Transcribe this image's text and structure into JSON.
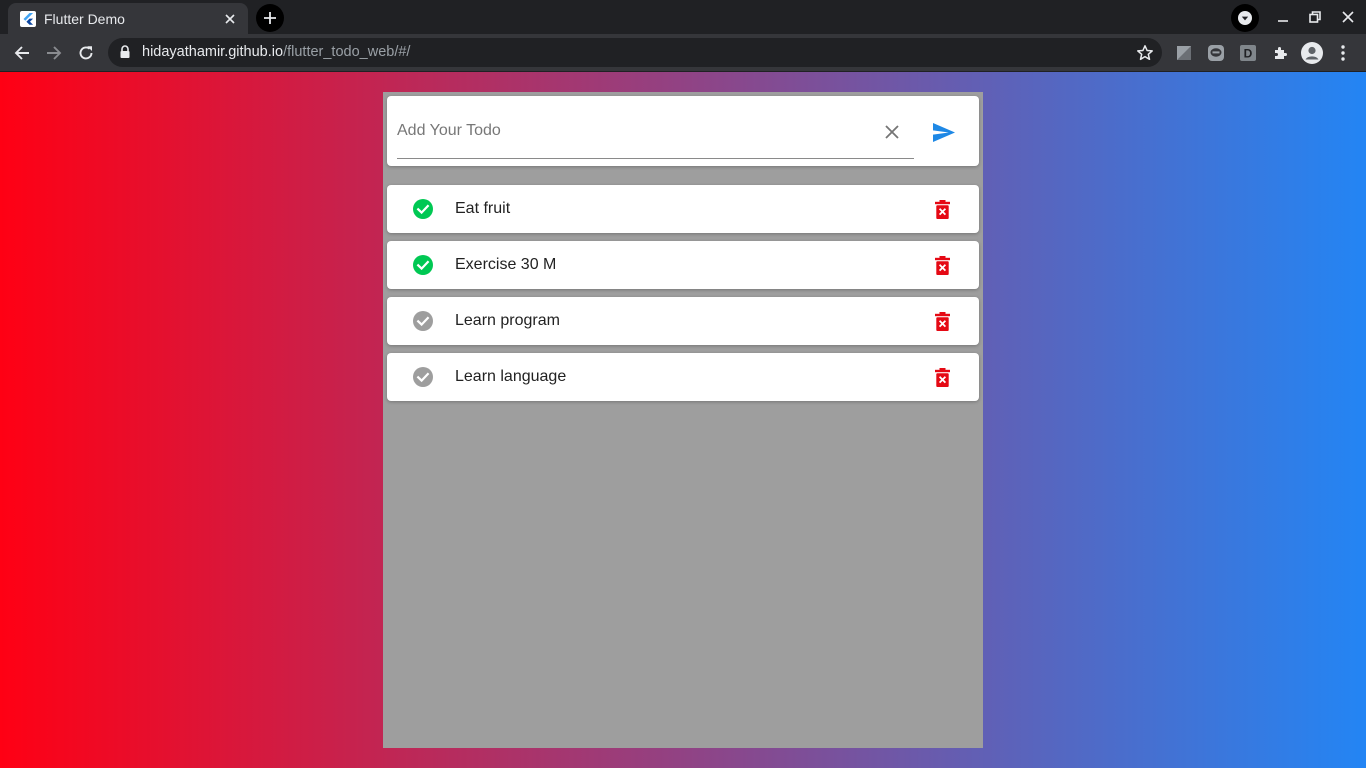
{
  "browser": {
    "tab": {
      "title": "Flutter Demo"
    },
    "omnibox": {
      "host": "hidayathamir.github.io",
      "path": "/flutter_todo_web/#/"
    },
    "extensions": [
      "extension-icon",
      "line-icon",
      "d-extension-icon",
      "puzzle-icon",
      "profile-icon"
    ],
    "extension_letter": "D"
  },
  "app": {
    "input": {
      "placeholder": "Add Your Todo",
      "value": ""
    },
    "colors": {
      "gradient_start": "#ff0014",
      "gradient_end": "#2385f4",
      "panel": "#9e9e9e",
      "done": "#00c853",
      "pending": "#9e9e9e",
      "delete": "#e50914",
      "send": "#1e88e5"
    },
    "todos": [
      {
        "label": "Eat fruit",
        "done": true
      },
      {
        "label": "Exercise 30 M",
        "done": true
      },
      {
        "label": "Learn program",
        "done": false
      },
      {
        "label": "Learn language",
        "done": false
      }
    ]
  }
}
